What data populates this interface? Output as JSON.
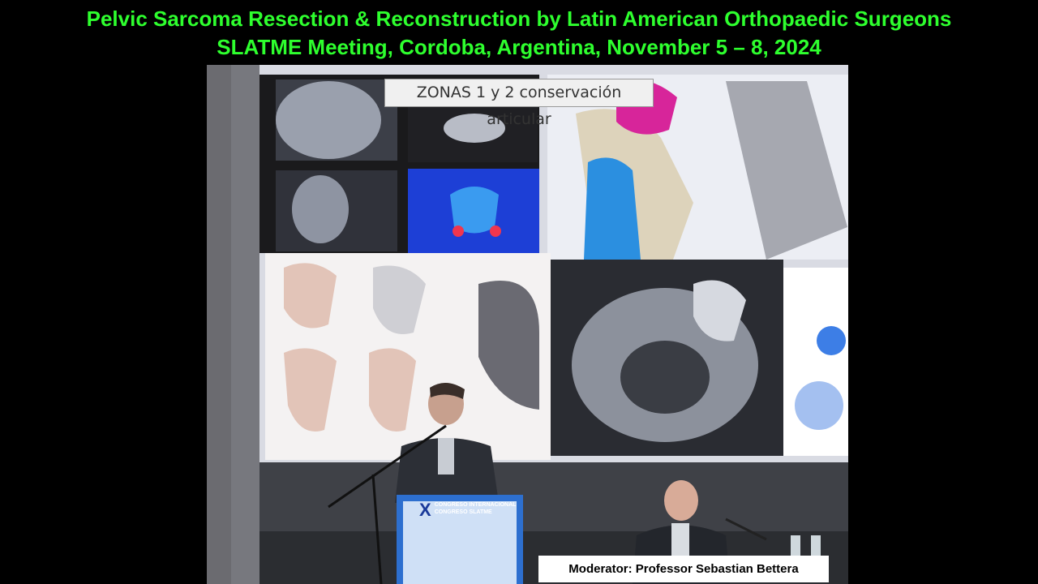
{
  "header": {
    "line1": "Pelvic Sarcoma Resection & Reconstruction by Latin American Orthopaedic Surgeons",
    "line2": "SLATME Meeting, Cordoba, Argentina, November 5 – 8, 2024"
  },
  "slide": {
    "title": "ZONAS 1 y 2 conservación articular"
  },
  "podium": {
    "numeral": "X",
    "line1": "CONGRESO INTERNACIONAL",
    "line2": "CONGRESO SLATME"
  },
  "caption": {
    "moderator": "Moderator: Professor Sebastian Bettera"
  },
  "colors": {
    "header_text": "#2eff2e",
    "background": "#000000",
    "caption_bg": "#ffffff"
  }
}
